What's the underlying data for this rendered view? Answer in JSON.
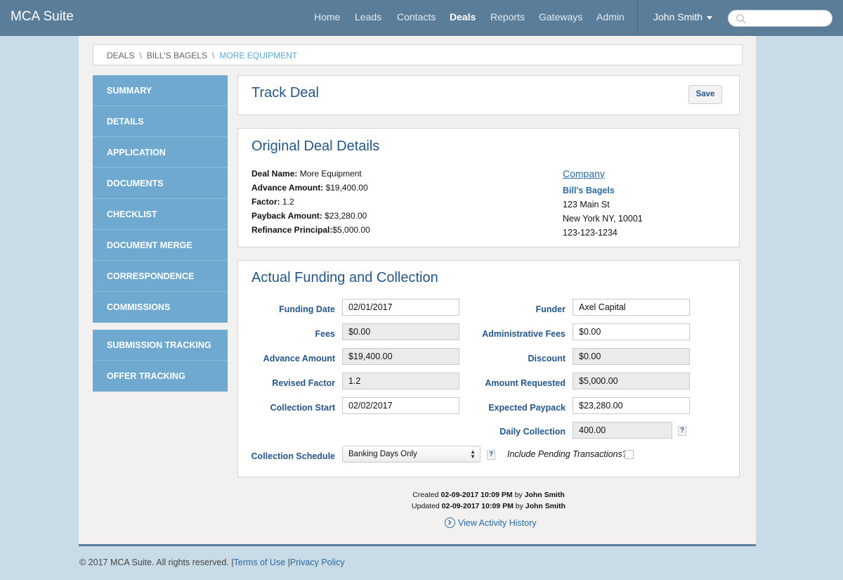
{
  "app": {
    "title": "MCA Suite"
  },
  "nav": {
    "items": [
      {
        "label": "Home"
      },
      {
        "label": "Leads"
      },
      {
        "label": "Contacts"
      },
      {
        "label": "Deals",
        "active": true
      },
      {
        "label": "Reports"
      },
      {
        "label": "Gateways"
      },
      {
        "label": "Admin"
      }
    ],
    "user": "John Smith",
    "search_placeholder": ""
  },
  "breadcrumb": [
    "DEALS",
    "BILL'S BAGELS",
    "MORE EQUIPMENT"
  ],
  "sidebar": {
    "group1": [
      "SUMMARY",
      "DETAILS",
      "APPLICATION",
      "DOCUMENTS",
      "CHECKLIST",
      "DOCUMENT MERGE",
      "CORRESPONDENCE",
      "COMMISSIONS"
    ],
    "group2": [
      "SUBMISSION TRACKING",
      "OFFER TRACKING"
    ]
  },
  "track": {
    "title": "Track Deal",
    "save_label": "Save"
  },
  "original": {
    "title": "Original Deal Details",
    "details": [
      {
        "label": "Deal Name:",
        "value": " More Equipment"
      },
      {
        "label": "Advance Amount:",
        "value": " $19,400.00"
      },
      {
        "label": "Factor:",
        "value": " 1.2"
      },
      {
        "label": "Payback Amount:",
        "value": " $23,280.00"
      },
      {
        "label": "Refinance Principal:",
        "value": "$5,000.00"
      }
    ],
    "company_heading": "Company",
    "company_name": "Bill's Bagels",
    "address1": "123 Main St",
    "address2": "New York NY, 10001",
    "phone": "123-123-1234"
  },
  "actual": {
    "title": "Actual Funding and Collection",
    "funding_date": {
      "label": "Funding Date",
      "value": "02/01/2017"
    },
    "fees": {
      "label": "Fees",
      "value": "$0.00"
    },
    "advance_amount": {
      "label": "Advance Amount",
      "value": "$19,400.00"
    },
    "revised_factor": {
      "label": "Revised Factor",
      "value": "1.2"
    },
    "collection_start": {
      "label": "Collection Start",
      "value": "02/02/2017"
    },
    "collection_schedule": {
      "label": "Collection Schedule",
      "value": "Banking Days Only"
    },
    "funder": {
      "label": "Funder",
      "value": "Axel Capital"
    },
    "admin_fees": {
      "label": "Administrative Fees",
      "value": "$0.00"
    },
    "discount": {
      "label": "Discount",
      "value": "$0.00"
    },
    "amount_requested": {
      "label": "Amount Requested",
      "value": "$5,000.00"
    },
    "expected_payback": {
      "label": "Expected Paypack",
      "value": "$23,280.00"
    },
    "daily_collection": {
      "label": "Daily Collection",
      "value": "400.00"
    },
    "include_pending": "Include Pending Transactions?",
    "help": "?"
  },
  "meta": {
    "created_prefix": "Created",
    "created_date": "02-09-2017 10:09 PM",
    "created_by_word": "by",
    "created_by": "John Smith",
    "updated_prefix": "Updated",
    "updated_date": "02-09-2017 10:09 PM",
    "updated_by_word": "by",
    "updated_by": "John Smith",
    "history_link": "View Activity History"
  },
  "footer": {
    "copyright": "© 2017 MCA Suite. All rights reserved.",
    "sep": "|",
    "terms": "Terms of Use",
    "privacy": "Privacy Policy"
  }
}
